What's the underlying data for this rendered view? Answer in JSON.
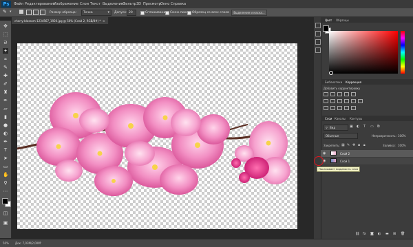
{
  "app": {
    "logo": "Ps"
  },
  "menubar": {
    "items": [
      "Файл",
      "Редактирование",
      "Изображение",
      "Слои",
      "Текст",
      "Выделение",
      "Фильтр",
      "3D",
      "Просмотр",
      "Окно",
      "Справка"
    ]
  },
  "options_bar": {
    "sample_size_label": "Размер образца:",
    "sample_size_value": "Точка",
    "tolerance_label": "Допуск:",
    "tolerance_value": "20",
    "antialias_label": "Сглаживание",
    "contiguous_label": "Смеж.пикс",
    "all_layers_label": "Образец со всех слоев",
    "refine_button": "Выделение и маска..."
  },
  "document": {
    "tab_title": "cherry-blossom-1234567_1920.jpg @ 50% (Слой 2, RGB/8#) *",
    "close": "×"
  },
  "status": {
    "zoom": "50%",
    "doc_info": "Док: 7,03M/2,00M"
  },
  "color_panel": {
    "tabs": [
      "Цвет",
      "Образцы"
    ],
    "accent_red": "#ff0000"
  },
  "adjustments_panel": {
    "tabs": [
      "Библиотеки",
      "Коррекция"
    ],
    "add_label": "Добавить корректировку"
  },
  "layers_panel": {
    "tabs": [
      "Слои",
      "Каналы",
      "Контуры"
    ],
    "filter_label": "Вид",
    "blend_mode": "Обычные",
    "opacity_label": "Непрозрачность:",
    "opacity_value": "100%",
    "lock_label": "Закрепить:",
    "fill_label": "Заливка:",
    "fill_value": "100%",
    "layers": [
      {
        "name": "Слой 2",
        "selected": true
      },
      {
        "name": "Слой 1",
        "selected": false
      }
    ],
    "tooltip": "Показывает видимость слоя",
    "footer_icons": [
      "link-icon",
      "fx-icon",
      "mask-icon",
      "adjustment-icon",
      "folder-icon",
      "new-layer-icon",
      "trash-icon"
    ]
  },
  "colors": {
    "fg": "#000000",
    "bg": "#ffffff",
    "highlight_circle": "#e0141e"
  }
}
